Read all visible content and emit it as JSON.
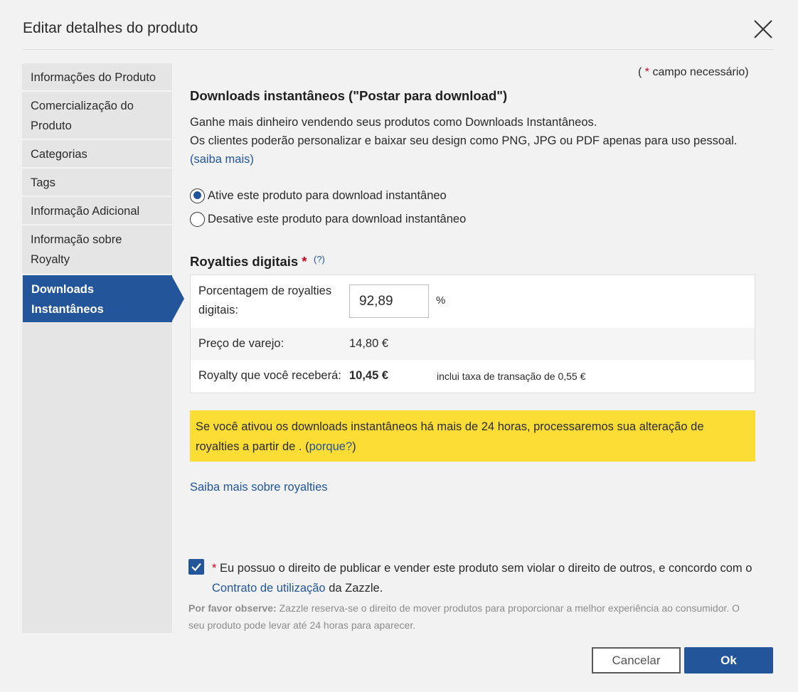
{
  "dialog": {
    "title": "Editar detalhes do produto"
  },
  "sidebar": {
    "items": [
      {
        "label": "Informações do Produto"
      },
      {
        "label": "Comercialização do Produto"
      },
      {
        "label": "Categorias"
      },
      {
        "label": "Tags"
      },
      {
        "label": "Informação Adicional"
      },
      {
        "label": "Informação sobre Royalty"
      },
      {
        "label": "Downloads Instantâneos",
        "active": true
      }
    ]
  },
  "main": {
    "required_note_prefix": "( ",
    "required_star": "*",
    "required_note_text": " campo necessário)",
    "section_title": "Downloads instantâneos (\"Postar para download\")",
    "desc_line1": "Ganhe mais dinheiro vendendo seus produtos como Downloads Instantâneos.",
    "desc_line2": "Os clientes poderão personalizar e baixar seu design como PNG, JPG ou PDF apenas para uso pessoal.",
    "learn_more_link": "(saiba mais)",
    "radio_enable": "Ative este produto para download instantâneo",
    "radio_disable": "Desative este produto para download instantâneo",
    "selected_option": "enable"
  },
  "royalties": {
    "title": "Royalties digitais",
    "required_star": "*",
    "help": "(?)",
    "pct_label": "Porcentagem de royalties digitais:",
    "pct_value": "92,89",
    "pct_unit": "%",
    "retail_label": "Preço de varejo:",
    "retail_value": "14,80 €",
    "receive_label": "Royalty que você receberá:",
    "receive_value": "10,45 €",
    "fee_note": "inclui taxa de transação de 0,55 €"
  },
  "notice": {
    "text": "Se você ativou os downloads instantâneos há mais de 24 horas, processaremos sua alteração de royalties a partir de . (",
    "link": "porque?",
    "suffix": ")"
  },
  "learn_royalties_link": "Saiba mais sobre royalties",
  "agreement": {
    "checked": true,
    "star": "*",
    "text_before": " Eu possuo o direito de publicar e vender este produto sem violar o direito de outros, e concordo com o ",
    "link": "Contrato de utilização",
    "text_after": " da Zazzle."
  },
  "note": {
    "label": "Por favor observe:",
    "text": " Zazzle reserva-se o direito de mover produtos para proporcionar a melhor experiência ao consumidor. O seu produto pode levar até 24 horas para aparecer."
  },
  "buttons": {
    "cancel": "Cancelar",
    "ok": "Ok"
  },
  "colors": {
    "accent": "#23559a",
    "notice_bg": "#fcdd36",
    "required": "#d0021b"
  }
}
